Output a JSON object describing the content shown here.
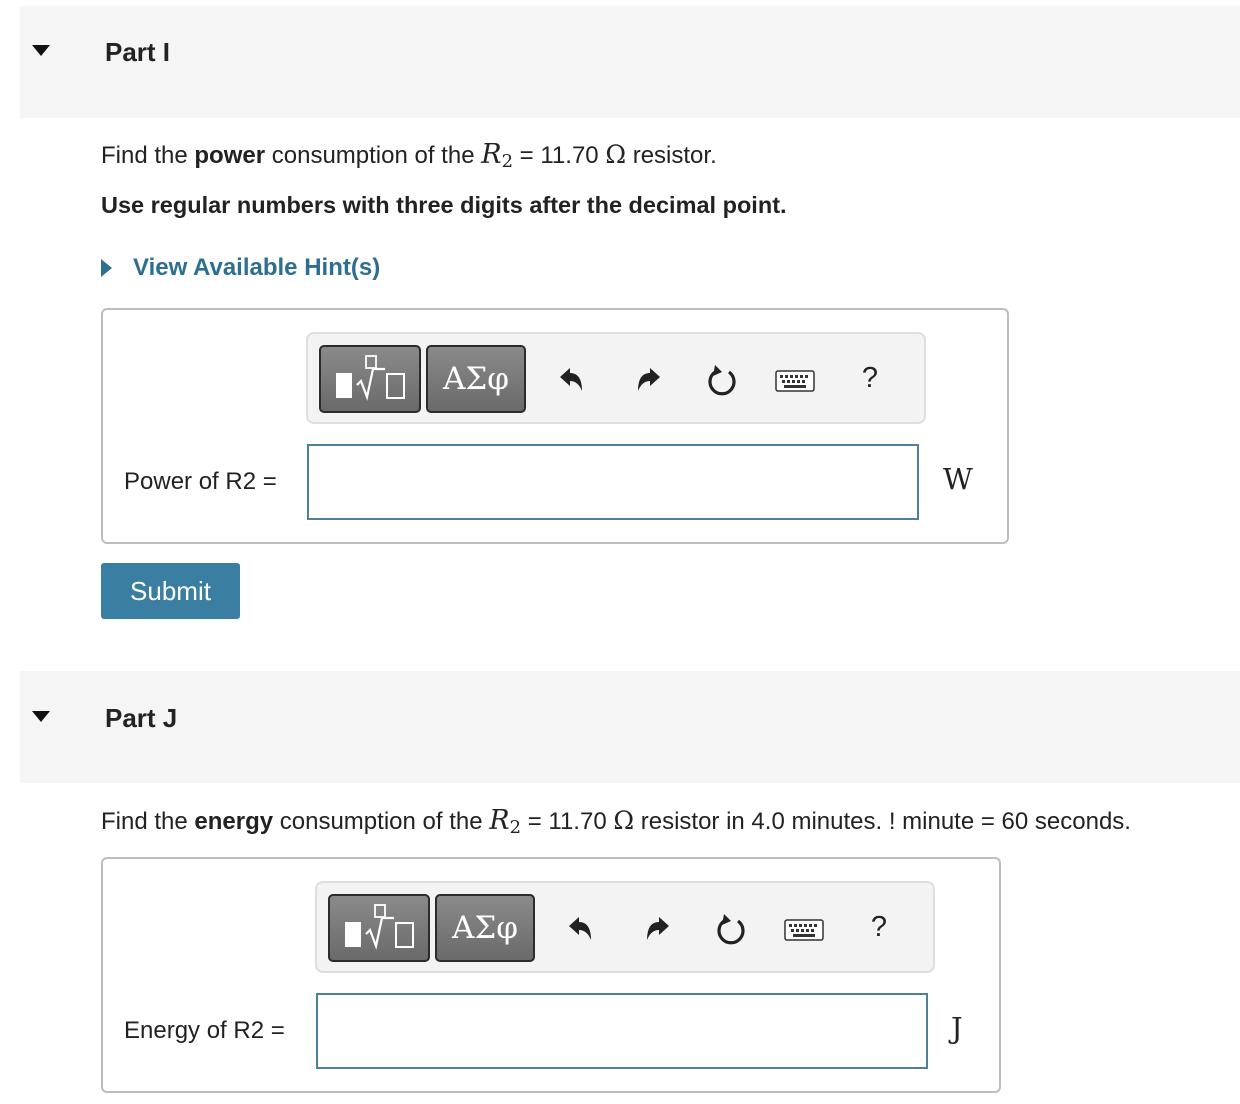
{
  "part_i": {
    "title": "Part I",
    "question": {
      "prefix": "Find the ",
      "bold": "power",
      "mid": " consumption of the ",
      "var": "R",
      "sub": "2",
      "eq": " = 11.70 ",
      "omega": "Ω",
      "suffix": " resistor."
    },
    "instruction": "Use regular numbers with three digits after the decimal point.",
    "hint_label": "View Available Hint(s)",
    "toolbar": {
      "greek_label": "ΑΣφ",
      "help_label": "?"
    },
    "answer_label": "Power of R2 =",
    "answer_value": "",
    "unit": "W",
    "submit_label": "Submit"
  },
  "part_j": {
    "title": "Part J",
    "question": {
      "prefix": "Find the ",
      "bold": "energy",
      "mid": " consumption of the ",
      "var": "R",
      "sub": "2",
      "eq": " = 11.70 ",
      "omega": "Ω",
      "suffix": " resistor in 4.0 minutes. ! minute = 60 seconds."
    },
    "toolbar": {
      "greek_label": "ΑΣφ",
      "help_label": "?"
    },
    "answer_label": "Energy of R2 =",
    "answer_value": "",
    "unit": "J"
  },
  "icons": {
    "toggle": "triangle-down-icon",
    "hint": "triangle-right-icon",
    "templates": "templates-icon",
    "undo": "undo-icon",
    "redo": "redo-icon",
    "reset": "reset-icon",
    "keyboard": "keyboard-icon"
  },
  "colors": {
    "link": "#2d6f91",
    "submit": "#3a7ea1",
    "input_border": "#4f8098",
    "header_bg": "#f5f5f5",
    "toolbar_button": "#7a7a7a"
  }
}
